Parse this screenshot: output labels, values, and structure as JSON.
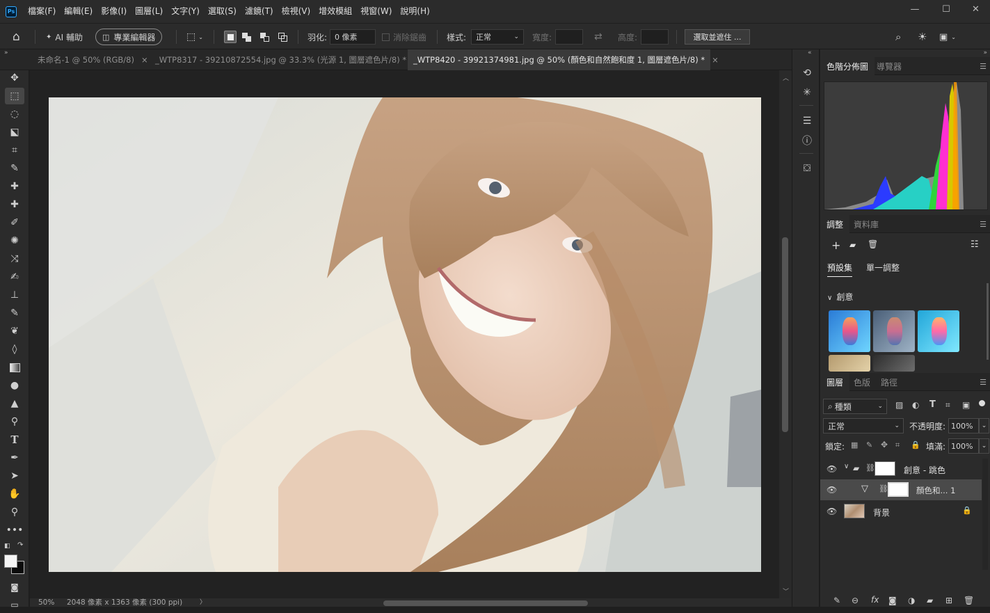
{
  "app": {
    "logo": "Ps"
  },
  "menu": [
    "檔案(F)",
    "編輯(E)",
    "影像(I)",
    "圖層(L)",
    "文字(Y)",
    "選取(S)",
    "濾鏡(T)",
    "檢視(V)",
    "增效模組",
    "視窗(W)",
    "說明(H)"
  ],
  "options": {
    "ai_assist": "AI 輔助",
    "pro_editor": "專業編輯器",
    "feather_label": "羽化:",
    "feather_value": "0 像素",
    "antialias": "消除鋸齒",
    "style_label": "樣式:",
    "style_value": "正常",
    "width_label": "寬度:",
    "height_label": "高度:",
    "select_mask": "選取並遮住 ..."
  },
  "tabs": [
    {
      "label": "未命名-1 @ 50% (RGB/8)"
    },
    {
      "label": "_WTP8317 - 39210872554.jpg @ 33.3% (光源 1, 圖層遮色片/8) *"
    },
    {
      "label": "_WTP8420 - 39921374981.jpg @ 50% (顏色和自然飽和度 1, 圖層遮色片/8) *"
    }
  ],
  "status": {
    "zoom": "50%",
    "doc_info": "2048 像素 x 1363 像素 (300 ppi)"
  },
  "panels": {
    "histogram_tabs": [
      "色階分佈圖",
      "導覽器"
    ],
    "adjust_tabs": [
      "調整",
      "資料庫"
    ],
    "adjust_subtabs": [
      "預設集",
      "單一調整"
    ],
    "adjust_group": "創意",
    "layers_tabs": [
      "圖層",
      "色版",
      "路徑"
    ],
    "filter_kind": "種類",
    "blend_mode": "正常",
    "opacity_label": "不透明度:",
    "opacity_value": "100%",
    "lock_label": "鎖定:",
    "fill_label": "填滿:",
    "fill_value": "100%",
    "layers": [
      {
        "name": "創意 - 跳色"
      },
      {
        "name": "顏色和... 1"
      },
      {
        "name": "背景"
      }
    ]
  },
  "colors": {
    "accent": "#31a8ff",
    "ui_bg": "#2b2b2b"
  }
}
